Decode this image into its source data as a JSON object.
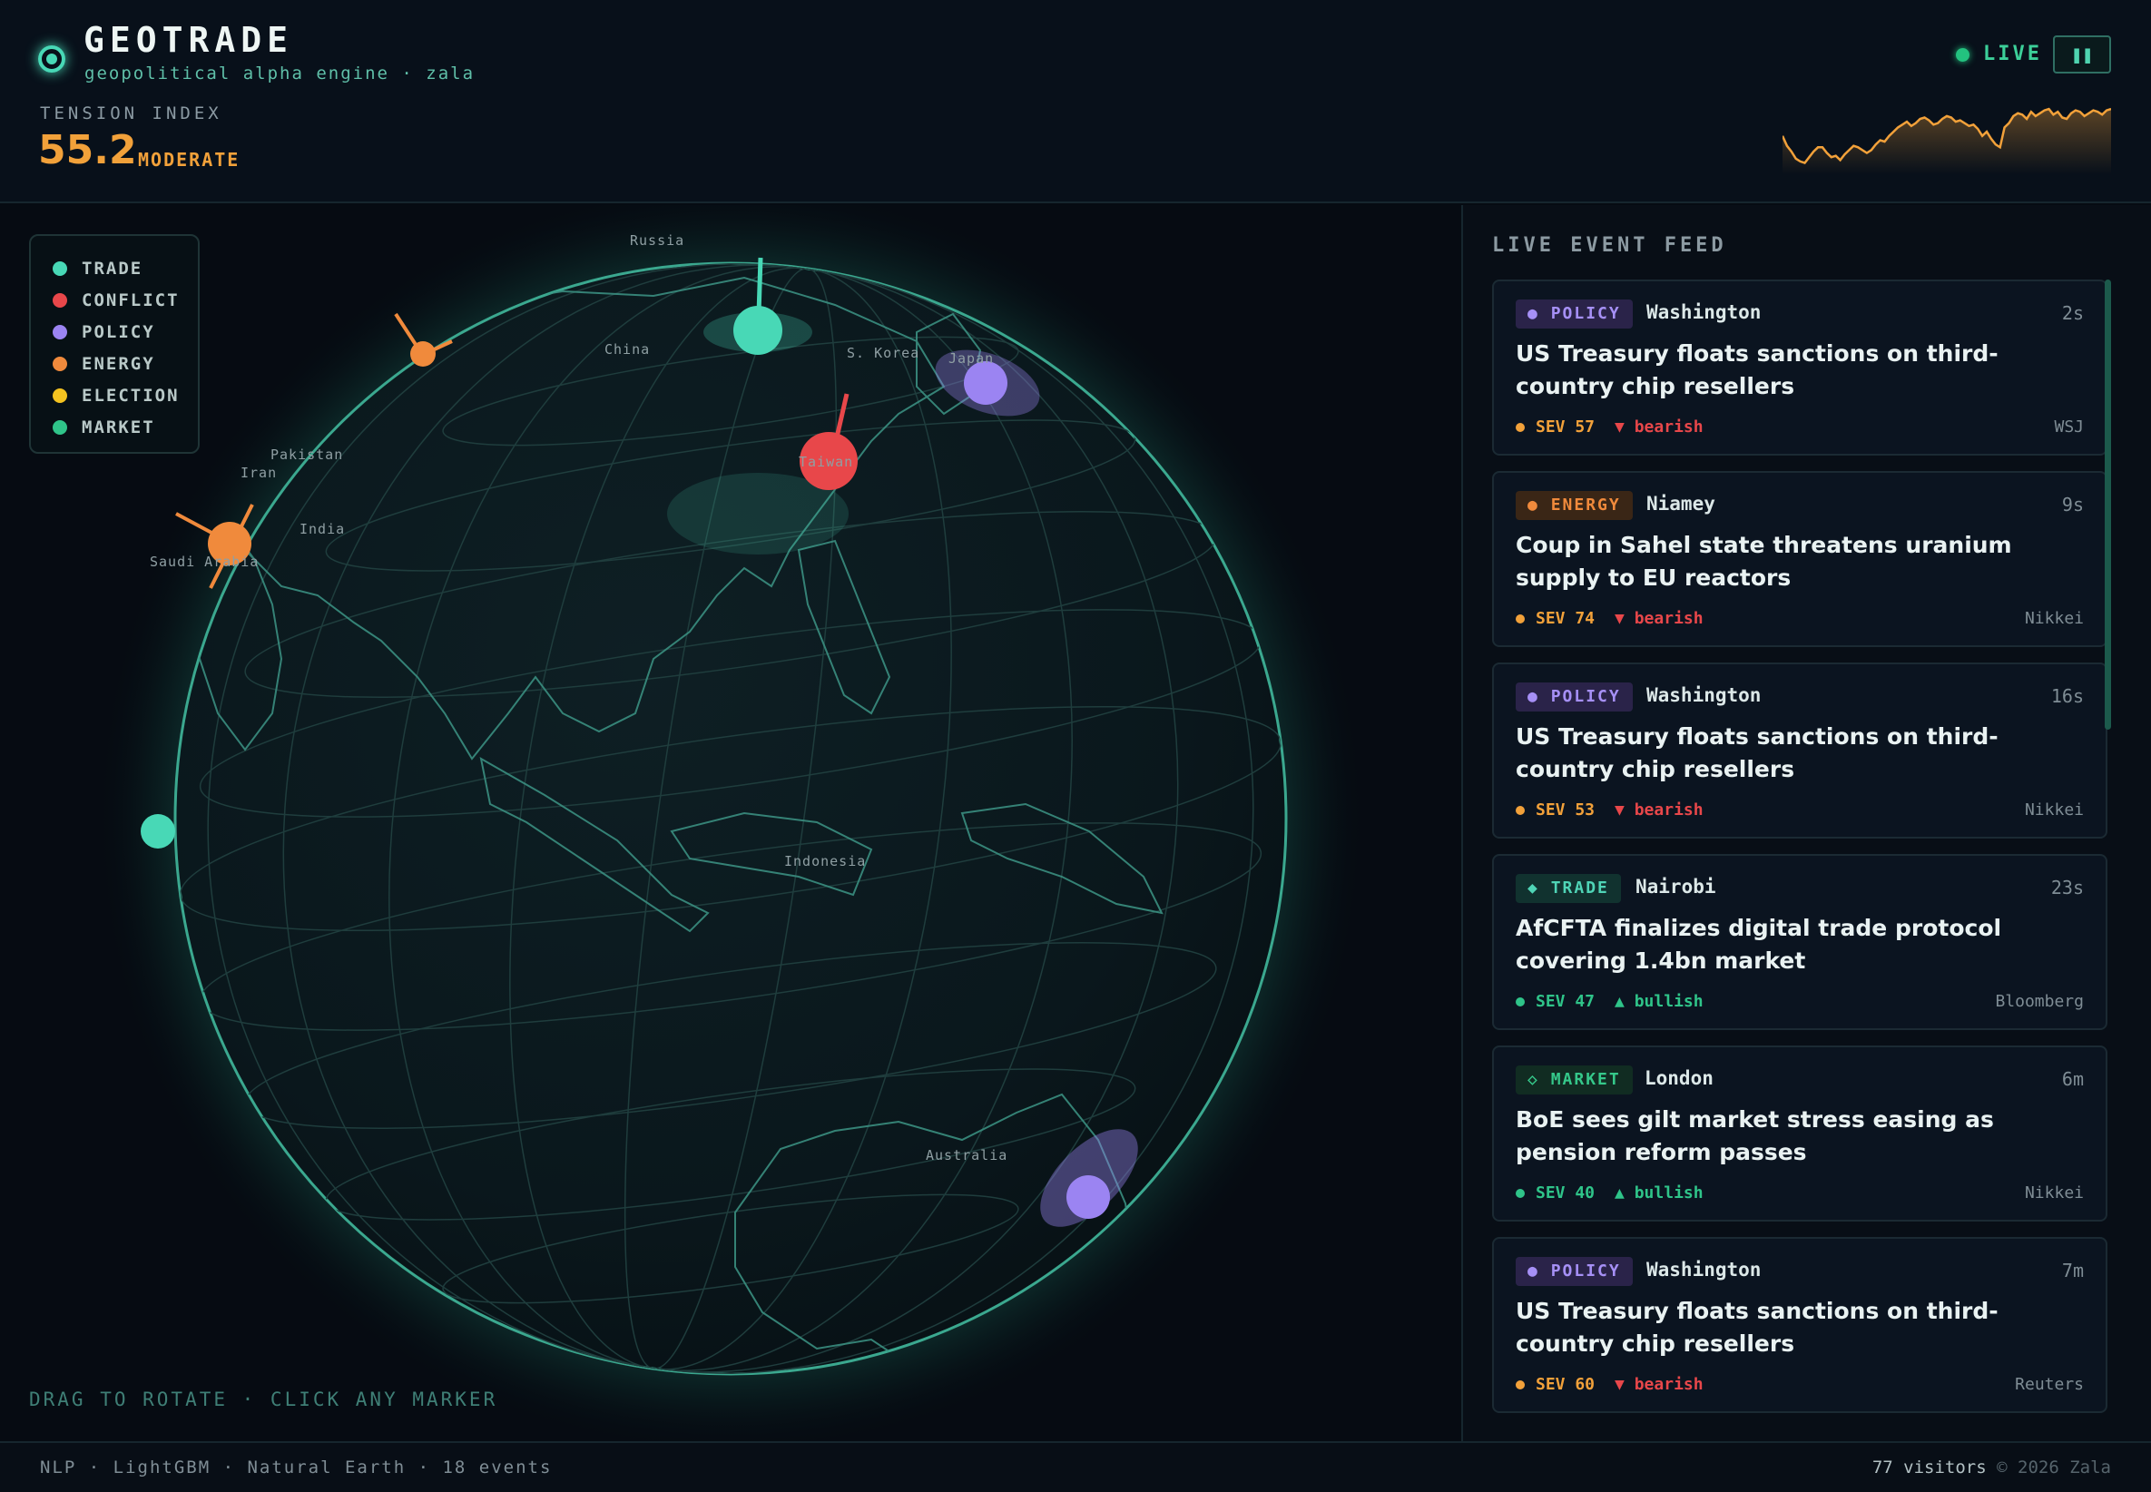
{
  "header": {
    "title": "GEOTRADE",
    "subtitle": "geopolitical alpha engine · zala",
    "tension_label": "TENSION INDEX",
    "tension_value": "55.2",
    "tension_level": "MODERATE",
    "live_label": "LIVE",
    "pause_icon": "pause-icon",
    "sparkline_points": [
      52,
      45,
      41,
      36,
      34,
      33,
      37,
      41,
      44,
      44,
      40,
      37,
      38,
      35,
      39,
      42,
      45,
      44,
      42,
      40,
      42,
      46,
      49,
      48,
      52,
      55,
      58,
      60,
      62,
      59,
      61,
      64,
      65,
      63,
      60,
      61,
      64,
      66,
      65,
      62,
      63,
      61,
      59,
      60,
      57,
      52,
      55,
      50,
      46,
      44,
      58,
      61,
      66,
      68,
      67,
      64,
      69,
      66,
      68,
      70,
      71,
      67,
      69,
      65,
      64,
      68,
      70,
      69,
      66,
      68,
      70,
      69,
      67,
      70,
      71
    ]
  },
  "legend": [
    {
      "label": "TRADE",
      "color": "#48d8b6"
    },
    {
      "label": "CONFLICT",
      "color": "#e8474a"
    },
    {
      "label": "POLICY",
      "color": "#9b84f2"
    },
    {
      "label": "ENERGY",
      "color": "#f08a3c"
    },
    {
      "label": "ELECTION",
      "color": "#f4c320"
    },
    {
      "label": "MARKET",
      "color": "#2fc489"
    }
  ],
  "map": {
    "hint": "DRAG TO ROTATE · CLICK ANY MARKER",
    "places": [
      "Russia",
      "China",
      "S. Korea",
      "Japan",
      "Taiwan",
      "Pakistan",
      "Iran",
      "India",
      "Saudi Arabia",
      "Indonesia",
      "Australia"
    ]
  },
  "feed": {
    "title": "LIVE EVENT FEED",
    "events": [
      {
        "category": "POLICY",
        "icon": "dot",
        "location": "Washington",
        "age": "2s",
        "headline": "US Treasury floats sanctions on third-country chip resellers",
        "severity": "SEV 57",
        "trend": "bearish",
        "trend_icon": "▼",
        "source": "WSJ"
      },
      {
        "category": "ENERGY",
        "icon": "dot",
        "location": "Niamey",
        "age": "9s",
        "headline": "Coup in Sahel state threatens uranium supply to EU reactors",
        "severity": "SEV 74",
        "trend": "bearish",
        "trend_icon": "▼",
        "source": "Nikkei"
      },
      {
        "category": "POLICY",
        "icon": "dot",
        "location": "Washington",
        "age": "16s",
        "headline": "US Treasury floats sanctions on third-country chip resellers",
        "severity": "SEV 53",
        "trend": "bearish",
        "trend_icon": "▼",
        "source": "Nikkei"
      },
      {
        "category": "TRADE",
        "icon": "◆",
        "location": "Nairobi",
        "age": "23s",
        "headline": "AfCFTA finalizes digital trade protocol covering 1.4bn market",
        "severity": "SEV 47",
        "trend": "bullish",
        "trend_icon": "▲",
        "source": "Bloomberg"
      },
      {
        "category": "MARKET",
        "icon": "◇",
        "location": "London",
        "age": "6m",
        "headline": "BoE sees gilt market stress easing as pension reform passes",
        "severity": "SEV 40",
        "trend": "bullish",
        "trend_icon": "▲",
        "source": "Nikkei"
      },
      {
        "category": "POLICY",
        "icon": "dot",
        "location": "Washington",
        "age": "7m",
        "headline": "US Treasury floats sanctions on third-country chip resellers",
        "severity": "SEV 60",
        "trend": "bearish",
        "trend_icon": "▼",
        "source": "Reuters"
      }
    ]
  },
  "footer": {
    "left": "NLP · LightGBM · Natural Earth · 18 events",
    "visitors": "77 visitors",
    "copyright": "© 2026 Zala"
  }
}
